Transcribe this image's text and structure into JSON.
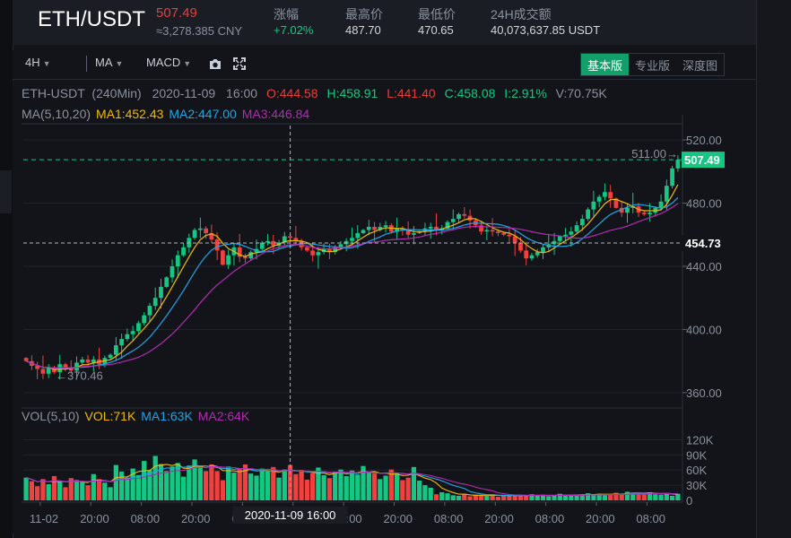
{
  "header": {
    "symbol": "ETH/USDT",
    "last_price": "507.49",
    "cny": "≈3,278.385 CNY",
    "stats": [
      {
        "label": "涨幅",
        "value": "+7.02%"
      },
      {
        "label": "最高价",
        "value": "487.70"
      },
      {
        "label": "最低价",
        "value": "470.65"
      },
      {
        "label": "24H成交额",
        "value": "40,073,637.85 USDT"
      }
    ]
  },
  "toolbar": {
    "interval": "4H",
    "indicator_main": "MA",
    "indicator_sub": "MACD",
    "tabs": [
      "基本版",
      "专业版",
      "深度图"
    ],
    "active_tab": "基本版"
  },
  "chart_data": {
    "type": "candlestick",
    "pair": "ETH-USDT",
    "interval_label": "(240Min)",
    "info_line": {
      "date": "2020-11-09",
      "time": "16:00",
      "open": "O:444.58",
      "high": "H:458.91",
      "low": "L:441.40",
      "close": "C:458.08",
      "change": "I:2.91%",
      "volume": "V:70.75K"
    },
    "ma_legend": {
      "title": "MA(5,10,20)",
      "ma1": "MA1:452.43",
      "ma2": "MA2:447.00",
      "ma3": "MA3:446.84"
    },
    "price_axis": {
      "ticks": [
        520,
        480,
        440,
        400,
        360
      ],
      "ylim": [
        352,
        528
      ]
    },
    "current_price": "507.49",
    "crosshair_price": "454.73",
    "high_annotation": "511.00→",
    "low_annotation": "←370.46",
    "vol_legend": {
      "title": "VOL(5,10)",
      "vol": "VOL:71K",
      "ma1": "MA1:63K",
      "ma2": "MA2:64K"
    },
    "volume_axis": {
      "ticks": [
        "120K",
        "90K",
        "60K",
        "30K",
        "0"
      ],
      "ylim": [
        0,
        135
      ]
    },
    "time_labels": [
      "11-02",
      "20:00",
      "08:00",
      "20:00",
      "08:00",
      "20:00",
      "08:00",
      "20:00",
      "08:00",
      "20:00",
      "08:00",
      "20:00",
      "08:00"
    ],
    "crosshair_time": "2020-11-09  16:00",
    "closes": [
      380,
      377,
      375,
      372,
      376,
      373,
      378,
      376,
      374,
      379,
      381,
      379,
      381,
      378,
      382,
      384,
      390,
      394,
      397,
      399,
      404,
      409,
      415,
      420,
      427,
      433,
      440,
      447,
      452,
      458,
      463,
      464,
      461,
      457,
      450,
      441,
      447,
      452,
      446,
      445,
      449,
      451,
      455,
      456,
      453,
      455,
      459,
      458,
      456,
      452,
      450,
      447,
      449,
      451,
      449,
      452,
      454,
      456,
      458,
      461,
      463,
      465,
      463,
      465,
      466,
      462,
      464,
      463,
      460,
      461,
      462,
      464,
      465,
      463,
      464,
      468,
      470,
      473,
      472,
      469,
      466,
      462,
      463,
      462,
      461,
      460,
      459,
      455,
      450,
      445,
      447,
      449,
      452,
      454,
      456,
      459,
      460,
      462,
      466,
      470,
      476,
      481,
      484,
      487,
      483,
      477,
      474,
      477,
      478,
      474,
      473,
      474,
      477,
      481,
      491,
      502,
      507.49
    ],
    "volumes": [
      45,
      38,
      28,
      42,
      32,
      48,
      37,
      26,
      44,
      40,
      36,
      30,
      52,
      42,
      35,
      26,
      70,
      57,
      45,
      63,
      50,
      78,
      60,
      88,
      72,
      58,
      67,
      74,
      47,
      69,
      81,
      68,
      58,
      71,
      58,
      40,
      67,
      55,
      62,
      71,
      53,
      49,
      63,
      57,
      66,
      45,
      61,
      70,
      52,
      60,
      41,
      54,
      65,
      50,
      44,
      57,
      61,
      48,
      59,
      51,
      68,
      55,
      53,
      42,
      49,
      61,
      54,
      40,
      45,
      66,
      39,
      30,
      25,
      12,
      16,
      14,
      10,
      9,
      13,
      8,
      11,
      10,
      9,
      12,
      7,
      10,
      9,
      11,
      8,
      10,
      12,
      9,
      11,
      8,
      10,
      13,
      9,
      11,
      10,
      12,
      14,
      11,
      13,
      10,
      12,
      15,
      13,
      17,
      15,
      12,
      14,
      16,
      12,
      11,
      14,
      9,
      13
    ]
  }
}
